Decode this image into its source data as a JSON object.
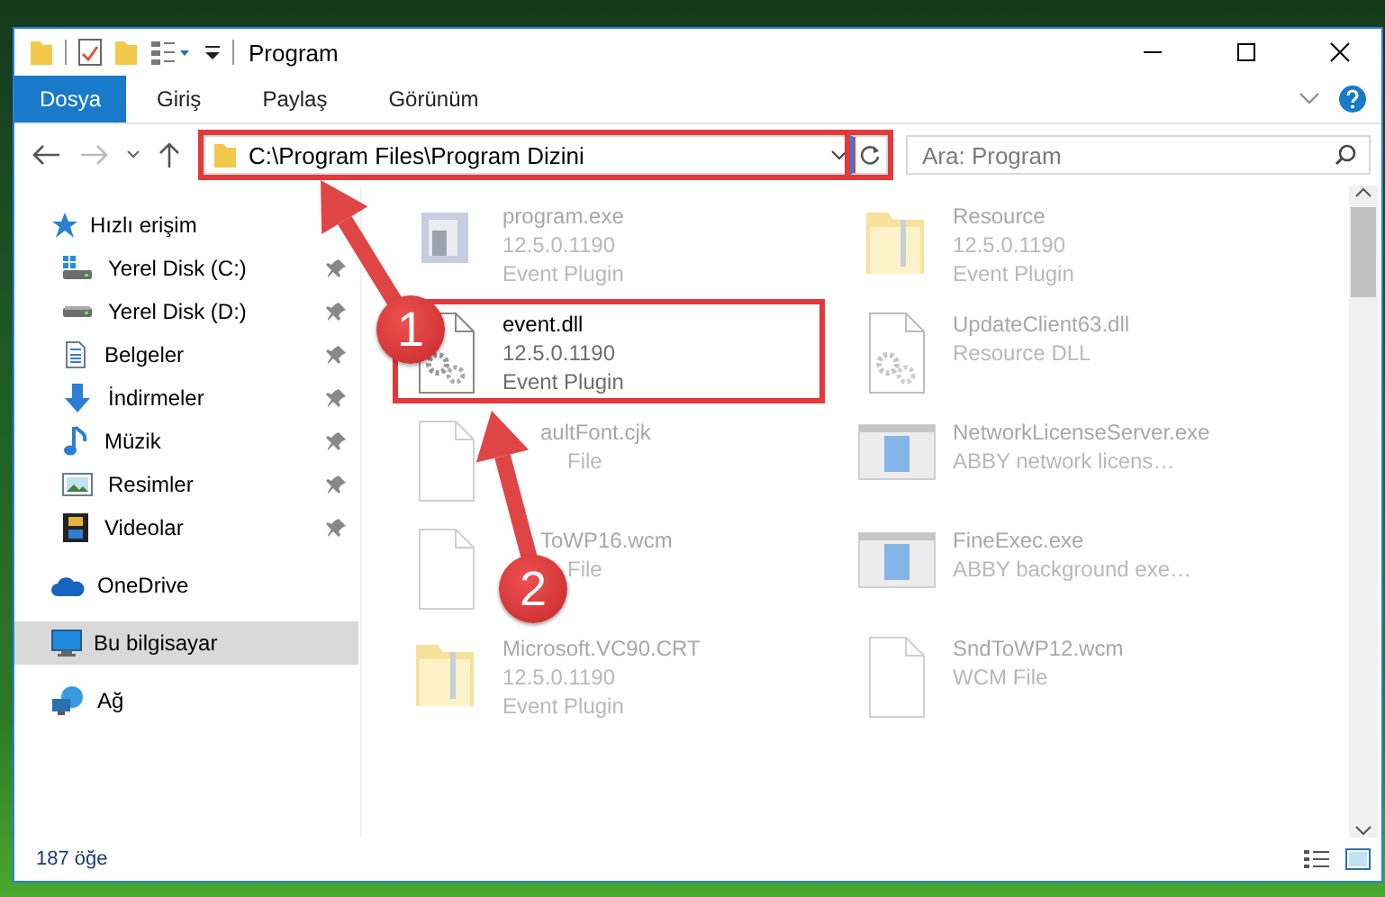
{
  "window": {
    "title": "Program"
  },
  "ribbon_tabs": [
    {
      "label": "Dosya",
      "selected": true
    },
    {
      "label": "Giriş",
      "selected": false
    },
    {
      "label": "Paylaş",
      "selected": false
    },
    {
      "label": "Görünüm",
      "selected": false
    }
  ],
  "address": {
    "path": "C:\\Program Files\\Program Dizini",
    "highlighted": true
  },
  "search": {
    "placeholder": "Ara: Program"
  },
  "sidebar": {
    "items": [
      {
        "label": "Hızlı erişim",
        "kind": "star",
        "selected": false,
        "children": [
          {
            "label": "Yerel Disk (C:)",
            "kind": "system-drive",
            "pinned": true,
            "selected": false
          },
          {
            "label": "Yerel Disk (D:)",
            "kind": "drive",
            "pinned": true,
            "selected": false
          },
          {
            "label": "Belgeler",
            "kind": "document",
            "pinned": true,
            "selected": false
          },
          {
            "label": "İndirmeler",
            "kind": "download",
            "pinned": true,
            "selected": false
          },
          {
            "label": "Müzik",
            "kind": "music",
            "pinned": true,
            "selected": false
          },
          {
            "label": "Resimler",
            "kind": "image",
            "pinned": true,
            "selected": false
          },
          {
            "label": "Videolar",
            "kind": "video",
            "pinned": true,
            "selected": false
          }
        ]
      },
      {
        "label": "OneDrive",
        "kind": "cloud",
        "selected": false
      },
      {
        "label": "Bu bilgisayar",
        "kind": "computer",
        "selected": true
      },
      {
        "label": "Ağ",
        "kind": "network",
        "selected": false
      }
    ]
  },
  "files": [
    {
      "name": "program.exe",
      "details": [
        "12.5.0.1190",
        "Event Plugin"
      ],
      "kind": "exe",
      "blurred": true,
      "highlighted": false
    },
    {
      "name": "Resource",
      "details": [
        "12.5.0.1190",
        "Event Plugin"
      ],
      "kind": "folder",
      "blurred": true,
      "highlighted": false
    },
    {
      "name": "event.dll",
      "details": [
        "12.5.0.1190",
        "Event Plugin"
      ],
      "kind": "dll",
      "blurred": false,
      "highlighted": true
    },
    {
      "name": "UpdateClient63.dll",
      "details": [
        "Resource DLL"
      ],
      "kind": "dll",
      "blurred": true,
      "highlighted": false
    },
    {
      "name": "aultFont.cjk",
      "details": [
        "File"
      ],
      "kind": "blank",
      "blurred": true,
      "highlighted": false,
      "covered": true
    },
    {
      "name": "NetworkLicenseServer.exe",
      "details": [
        "ABBY network licens…"
      ],
      "kind": "app",
      "blurred": true,
      "highlighted": false
    },
    {
      "name": "ToWP16.wcm",
      "details": [
        "File"
      ],
      "kind": "blank",
      "blurred": true,
      "highlighted": false,
      "covered": true
    },
    {
      "name": "FineExec.exe",
      "details": [
        "ABBY background exe…"
      ],
      "kind": "app",
      "blurred": true,
      "highlighted": false
    },
    {
      "name": "Microsoft.VC90.CRT",
      "details": [
        "12.5.0.1190",
        "Event Plugin"
      ],
      "kind": "folder",
      "blurred": true,
      "highlighted": false
    },
    {
      "name": "SndToWP12.wcm",
      "details": [
        "WCM File"
      ],
      "kind": "blank",
      "blurred": true,
      "highlighted": false
    }
  ],
  "status_bar": {
    "count": "187 öğe"
  },
  "annotations": [
    {
      "label": "1"
    },
    {
      "label": "2"
    }
  ]
}
